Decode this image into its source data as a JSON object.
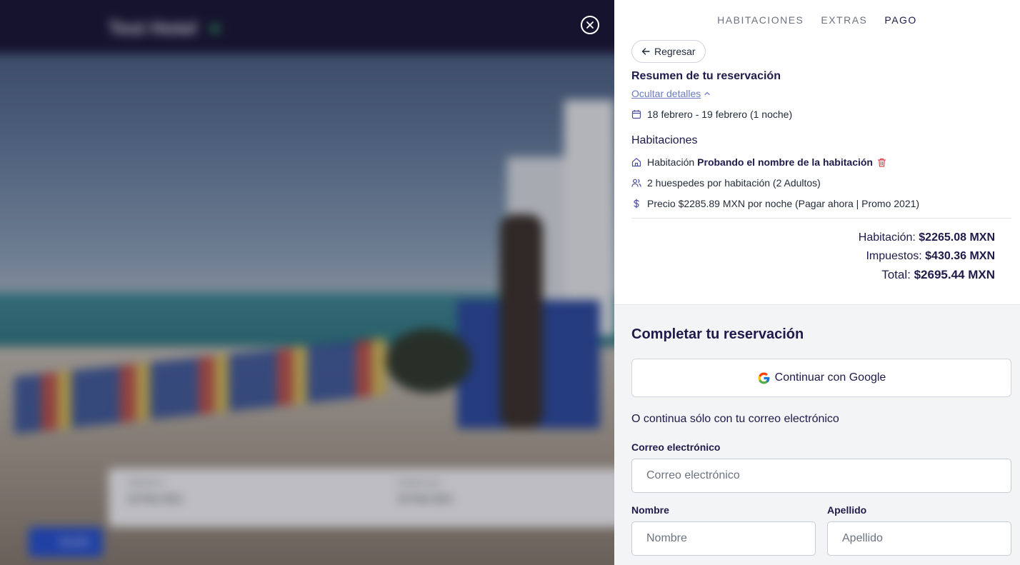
{
  "backdrop": {
    "hotel_name": "Test Hotel",
    "checkin_label": "Check-in",
    "checkin_value": "18 Feb 2021",
    "checkout_label": "Check-out",
    "checkout_value": "19 Feb 2021",
    "help_label": "Ayuda"
  },
  "steps": [
    "HABITACIONES",
    "EXTRAS",
    "PAGO"
  ],
  "back_label": "Regresar",
  "summary": {
    "title": "Resumen de tu reservación",
    "toggle_label": "Ocultar detalles",
    "dates": "18 febrero - 19 febrero (1 noche)",
    "rooms_title": "Habitaciones",
    "room_prefix": "Habitación",
    "room_name": "Probando el nombre de la habitación",
    "guests": "2 huespedes por habitación (2 Adultos)",
    "price": "Precio $2285.89 MXN por noche (Pagar ahora | Promo 2021)",
    "room_total_label": "Habitación:",
    "room_total_value": "$2265.08 MXN",
    "taxes_label": "Impuestos:",
    "taxes_value": "$430.36 MXN",
    "total_label": "Total:",
    "total_value": "$2695.44 MXN"
  },
  "checkout": {
    "title": "Completar tu reservación",
    "google_label": "Continuar con Google",
    "or_label": "O continua sólo con tu correo electrónico",
    "email_label": "Correo electrónico",
    "email_placeholder": "Correo electrónico",
    "first_name_label": "Nombre",
    "first_name_placeholder": "Nombre",
    "last_name_label": "Apellido",
    "last_name_placeholder": "Apellido"
  },
  "colors": {
    "accent": "#1e1b4b",
    "link": "#6b7cc0",
    "trash": "#e0464a",
    "nav_bg": "#171333"
  }
}
